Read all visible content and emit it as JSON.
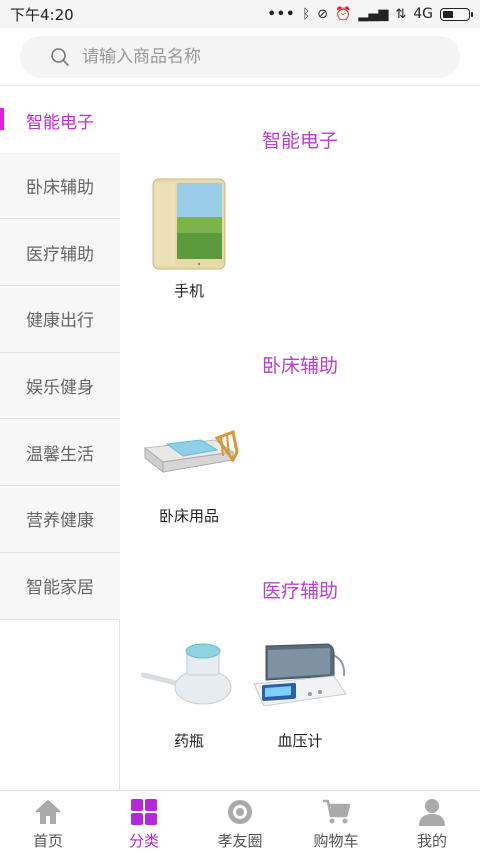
{
  "status": {
    "time": "下午4:20",
    "network": "4G"
  },
  "search": {
    "placeholder": "请输入商品名称"
  },
  "sidebar": {
    "items": [
      {
        "label": "智能电子"
      },
      {
        "label": "卧床辅助"
      },
      {
        "label": "医疗辅助"
      },
      {
        "label": "健康出行"
      },
      {
        "label": "娱乐健身"
      },
      {
        "label": "温馨生活"
      },
      {
        "label": "营养健康"
      },
      {
        "label": "智能家居"
      }
    ]
  },
  "sections": [
    {
      "title": "智能电子",
      "products": [
        {
          "label": "手机",
          "icon": "phone-icon"
        }
      ]
    },
    {
      "title": "卧床辅助",
      "products": [
        {
          "label": "卧床用品",
          "icon": "bed-icon"
        }
      ]
    },
    {
      "title": "医疗辅助",
      "products": [
        {
          "label": "药瓶",
          "icon": "medicine-bottle-icon"
        },
        {
          "label": "血压计",
          "icon": "blood-pressure-monitor-icon"
        }
      ]
    }
  ],
  "tabs": [
    {
      "label": "首页",
      "icon": "home-icon"
    },
    {
      "label": "分类",
      "icon": "category-icon"
    },
    {
      "label": "孝友圈",
      "icon": "circle-icon"
    },
    {
      "label": "购物车",
      "icon": "cart-icon"
    },
    {
      "label": "我的",
      "icon": "user-icon"
    }
  ],
  "colors": {
    "accent": "#b93fd0",
    "active_bar": "#e020e0"
  }
}
